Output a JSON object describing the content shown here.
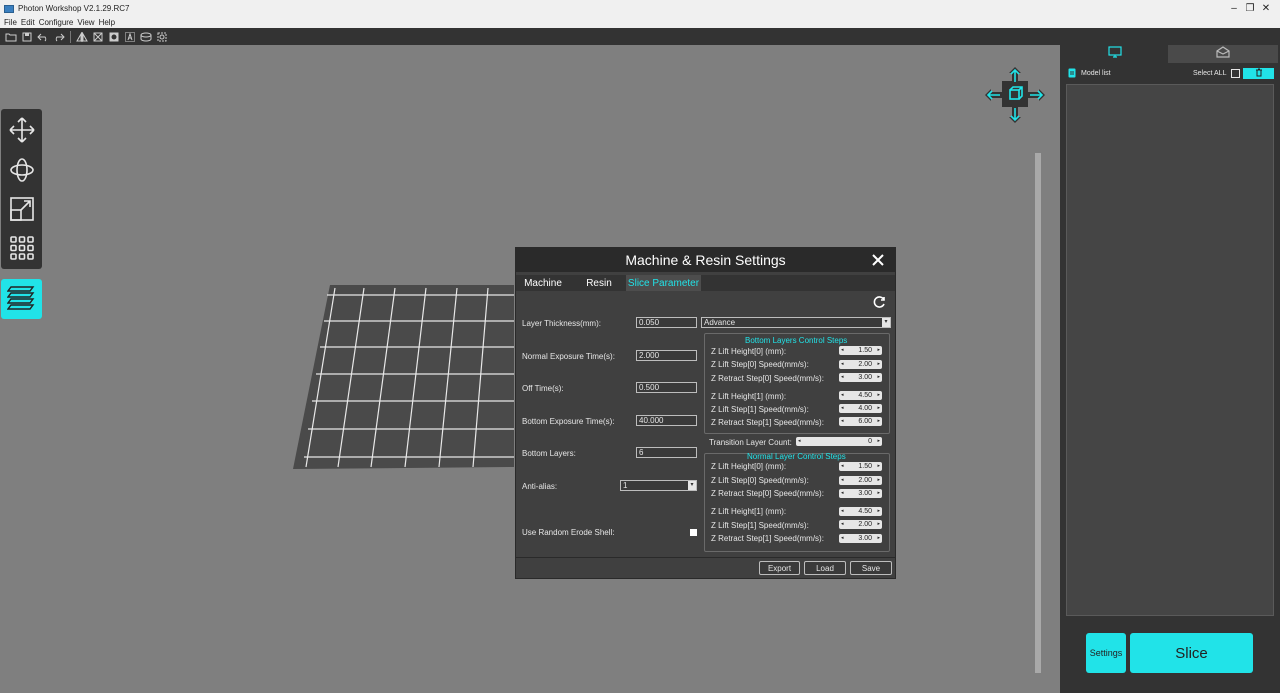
{
  "window": {
    "title": "Photon Workshop V2.1.29.RC7"
  },
  "menu": [
    "File",
    "Edit",
    "Configure",
    "View",
    "Help"
  ],
  "toolbar": {
    "icons": [
      "open-folder-icon",
      "save-icon",
      "undo-icon",
      "redo-icon",
      "mirror-icon",
      "hollow-icon",
      "punch-icon",
      "text-icon",
      "support-icon",
      "settings-icon"
    ]
  },
  "left_tools": [
    "move-icon",
    "rotate-icon",
    "scale-icon",
    "grid-arrange-icon",
    "layers-icon"
  ],
  "right_panel": {
    "model_list_label": "Model list",
    "select_all_label": "Select ALL",
    "settings_label": "Settings",
    "slice_label": "Slice"
  },
  "dialog": {
    "title": "Machine & Resin Settings",
    "tabs": [
      "Machine",
      "Resin",
      "Slice Parameter"
    ],
    "active_tab": "Slice Parameter",
    "fields": {
      "layer_thickness": {
        "label": "Layer Thickness(mm):",
        "value": "0.050"
      },
      "normal_exposure": {
        "label": "Normal Exposure Time(s):",
        "value": "2.000"
      },
      "off_time": {
        "label": "Off Time(s):",
        "value": "0.500"
      },
      "bottom_exposure": {
        "label": "Bottom Exposure Time(s):",
        "value": "40.000"
      },
      "bottom_layers": {
        "label": "Bottom Layers:",
        "value": "6"
      },
      "anti_alias": {
        "label": "Anti-alias:",
        "value": "1"
      },
      "random_erode": {
        "label": "Use Random Erode Shell:"
      }
    },
    "mode_select": "Advance",
    "bottom_group": {
      "title": "Bottom Layers Control Steps",
      "rows": [
        {
          "label": "Z Lift Height[0] (mm):",
          "value": "1.50"
        },
        {
          "label": "Z Lift Step[0] Speed(mm/s):",
          "value": "2.00"
        },
        {
          "label": "Z Retract Step[0] Speed(mm/s):",
          "value": "3.00"
        },
        {
          "label": "Z Lift Height[1] (mm):",
          "value": "4.50"
        },
        {
          "label": "Z Lift Step[1] Speed(mm/s):",
          "value": "4.00"
        },
        {
          "label": "Z Retract Step[1] Speed(mm/s):",
          "value": "6.00"
        }
      ]
    },
    "transition": {
      "label": "Transition Layer Count:",
      "value": "0"
    },
    "normal_group": {
      "title": "Normal Layer Control Steps",
      "rows": [
        {
          "label": "Z Lift Height[0] (mm):",
          "value": "1.50"
        },
        {
          "label": "Z Lift Step[0] Speed(mm/s):",
          "value": "2.00"
        },
        {
          "label": "Z Retract Step[0] Speed(mm/s):",
          "value": "3.00"
        },
        {
          "label": "Z Lift Height[1] (mm):",
          "value": "4.50"
        },
        {
          "label": "Z Lift Step[1] Speed(mm/s):",
          "value": "2.00"
        },
        {
          "label": "Z Retract Step[1] Speed(mm/s):",
          "value": "3.00"
        }
      ]
    },
    "buttons": {
      "export": "Export",
      "load": "Load",
      "save": "Save"
    }
  },
  "colors": {
    "accent": "#21e3e8",
    "panel": "#333333",
    "viewport": "#7f7f7f",
    "dialog": "#404040"
  }
}
